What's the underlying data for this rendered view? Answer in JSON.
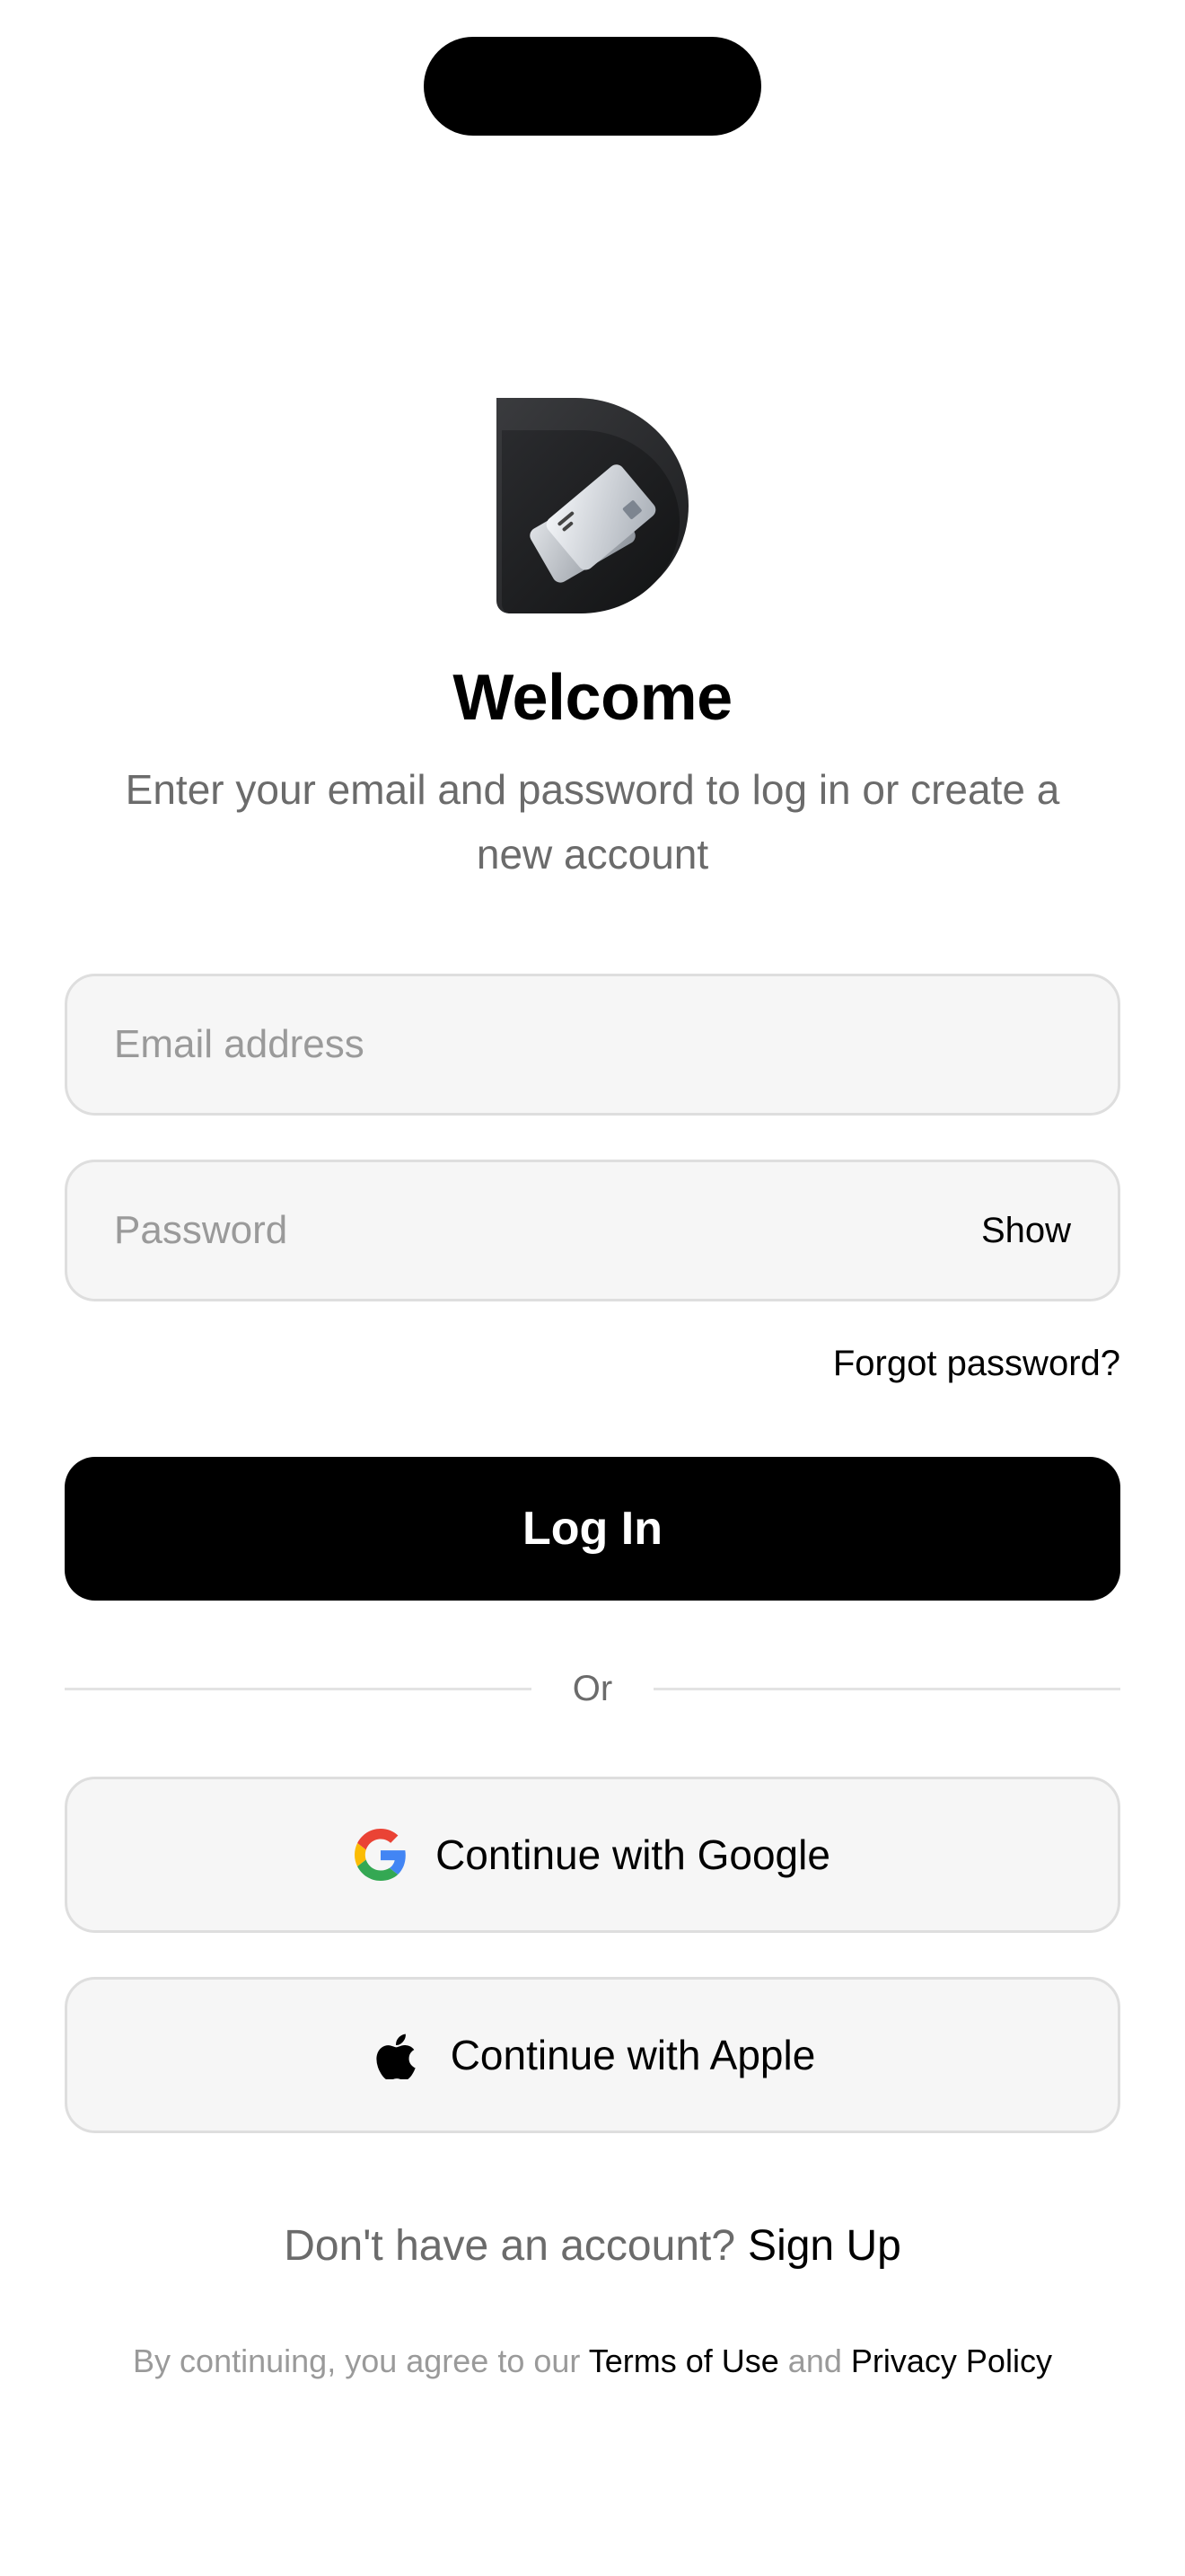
{
  "welcome": {
    "title": "Welcome",
    "subtitle": "Enter your email and password to log in or create a new account"
  },
  "form": {
    "email_placeholder": "Email address",
    "email_value": "",
    "password_placeholder": "Password",
    "password_value": "",
    "show_label": "Show",
    "forgot_label": "Forgot password?",
    "login_label": "Log In"
  },
  "divider": {
    "label": "Or"
  },
  "social": {
    "google_label": "Continue with Google",
    "google_icon": "google-icon",
    "apple_label": "Continue with Apple",
    "apple_icon": "apple-icon"
  },
  "signup": {
    "prompt": "Don't have an account?",
    "link": "Sign Up"
  },
  "legal": {
    "prefix": "By continuing, you agree to our",
    "terms": "Terms of Use",
    "and": "and",
    "privacy": "Privacy Policy"
  },
  "colors": {
    "primary": "#000000",
    "field_bg": "#f6f6f6",
    "field_border": "#dedede",
    "muted_text": "#6b6b6b",
    "placeholder": "#9a9a9a"
  }
}
